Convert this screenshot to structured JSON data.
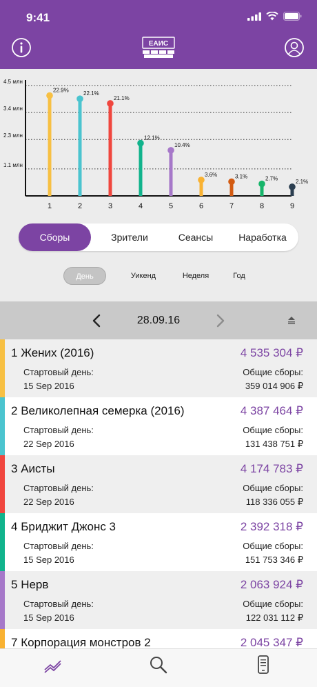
{
  "status": {
    "time": "9:41"
  },
  "header": {
    "logo_text": "ЕАИС"
  },
  "chart_data": {
    "type": "bar",
    "categories": [
      "1",
      "2",
      "3",
      "4",
      "5",
      "6",
      "7",
      "8",
      "9"
    ],
    "values": [
      4.09,
      3.96,
      3.77,
      2.15,
      1.86,
      0.65,
      0.58,
      0.49,
      0.37
    ],
    "labels": [
      "22.9%",
      "22.1%",
      "21.1%",
      "12.1%",
      "10.4%",
      "3.6%",
      "3.1%",
      "2.7%",
      "2.1%"
    ],
    "yticks": [
      {
        "value": 1.1,
        "label": "1.1 млн"
      },
      {
        "value": 2.3,
        "label": "2.3 млн"
      },
      {
        "value": 3.4,
        "label": "3.4 млн"
      },
      {
        "value": 4.5,
        "label": "4.5 млн"
      }
    ],
    "ylim": [
      0,
      4.5
    ],
    "colors": [
      "#f7c043",
      "#4bc4cf",
      "#f0463e",
      "#11b38c",
      "#a678c9",
      "#f9b232",
      "#d35b12",
      "#16b56a",
      "#2b3e50"
    ],
    "grid": true
  },
  "segments": [
    "Сборы",
    "Зрители",
    "Сеансы",
    "Наработка"
  ],
  "periods": [
    "День",
    "Уикенд",
    "Неделя",
    "Год"
  ],
  "date": "28.09.16",
  "list": {
    "start_label": "Стартовый день:",
    "total_label": "Общие сборы:",
    "items": [
      {
        "rank": "1",
        "title": "Жених (2016)",
        "gross": "4 535 304 ₽",
        "start": "15 Sep 2016",
        "total": "359 014 906 ₽",
        "color": "#f7c043"
      },
      {
        "rank": "2",
        "title": "Великолепная семерка (2016)",
        "gross": "4 387 464 ₽",
        "start": "22 Sep 2016",
        "total": "131 438 751 ₽",
        "color": "#4bc4cf"
      },
      {
        "rank": "3",
        "title": "Аисты",
        "gross": "4 174 783 ₽",
        "start": "22 Sep 2016",
        "total": "118 336 055 ₽",
        "color": "#f0463e"
      },
      {
        "rank": "4",
        "title": "Бриджит Джонс 3",
        "gross": "2 392 318 ₽",
        "start": "15 Sep 2016",
        "total": "151 753 346 ₽",
        "color": "#11b38c"
      },
      {
        "rank": "5",
        "title": "Нерв",
        "gross": "2 063 924 ₽",
        "start": "15 Sep 2016",
        "total": "122 031 112 ₽",
        "color": "#a678c9"
      },
      {
        "rank": "7",
        "title": "Корпорация монстров 2",
        "gross": "2 045 347 ₽",
        "start": "",
        "total": "",
        "color": "#f9b232"
      }
    ]
  }
}
